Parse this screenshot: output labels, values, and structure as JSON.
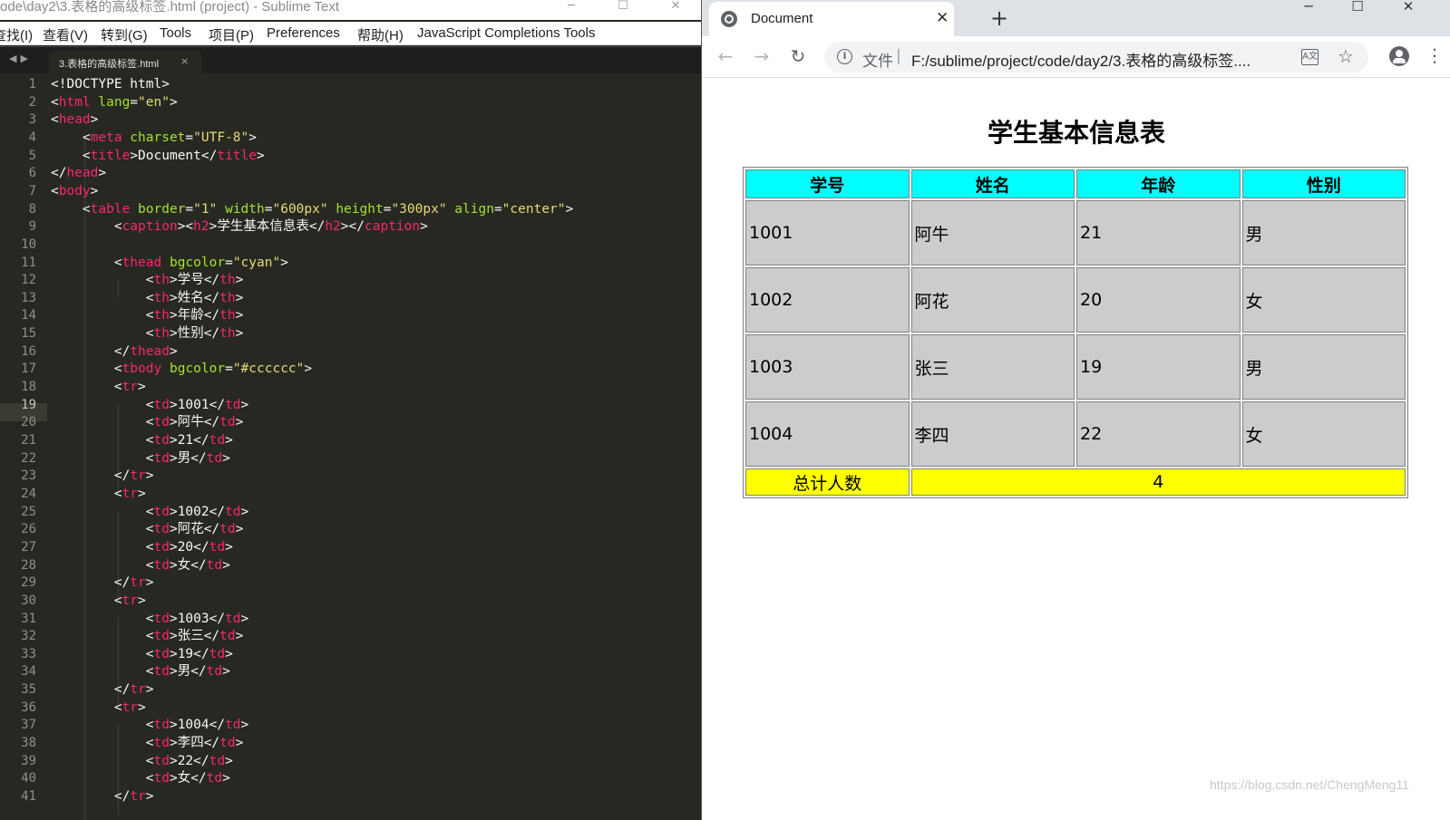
{
  "sublime": {
    "window_title": "ode\\day2\\3.表格的高级标签.html (project) - Sublime Text",
    "menu": [
      "查找(I)",
      "查看(V)",
      "转到(G)",
      "Tools",
      "项目(P)",
      "Preferences",
      "帮助(H)",
      "JavaScript Completions Tools"
    ],
    "tab_label": "3.表格的高级标签.html",
    "tab_close": "×",
    "current_line": 19,
    "line_numbers": [
      "1",
      "2",
      "3",
      "4",
      "5",
      "6",
      "7",
      "8",
      "9",
      "10",
      "11",
      "12",
      "13",
      "14",
      "15",
      "16",
      "17",
      "18",
      "19",
      "20",
      "21",
      "22",
      "23",
      "24",
      "25",
      "26",
      "27",
      "28",
      "29",
      "30",
      "31",
      "32",
      "33",
      "34",
      "35",
      "36",
      "37",
      "38",
      "39",
      "40",
      "41"
    ],
    "code_lines": [
      [
        [
          "t",
          "<!DOCTYPE html>"
        ]
      ],
      [
        [
          "t",
          "<"
        ],
        [
          "g",
          "html"
        ],
        [
          "a",
          " lang"
        ],
        [
          "t",
          "="
        ],
        [
          "s",
          "\"en\""
        ],
        [
          "t",
          ">"
        ]
      ],
      [
        [
          "t",
          "<"
        ],
        [
          "g",
          "head"
        ],
        [
          "t",
          ">"
        ]
      ],
      [
        [
          "t",
          "    <"
        ],
        [
          "g",
          "meta"
        ],
        [
          "a",
          " charset"
        ],
        [
          "t",
          "="
        ],
        [
          "s",
          "\"UTF-8\""
        ],
        [
          "t",
          ">"
        ]
      ],
      [
        [
          "t",
          "    <"
        ],
        [
          "g",
          "title"
        ],
        [
          "t",
          ">Document</"
        ],
        [
          "g",
          "title"
        ],
        [
          "t",
          ">"
        ]
      ],
      [
        [
          "t",
          "</"
        ],
        [
          "g",
          "head"
        ],
        [
          "t",
          ">"
        ]
      ],
      [
        [
          "t",
          "<"
        ],
        [
          "g",
          "body"
        ],
        [
          "t",
          ">"
        ]
      ],
      [
        [
          "t",
          "    <"
        ],
        [
          "g",
          "table"
        ],
        [
          "a",
          " border"
        ],
        [
          "t",
          "="
        ],
        [
          "s",
          "\"1\""
        ],
        [
          "a",
          " width"
        ],
        [
          "t",
          "="
        ],
        [
          "s",
          "\"600px\""
        ],
        [
          "a",
          " height"
        ],
        [
          "t",
          "="
        ],
        [
          "s",
          "\"300px\""
        ],
        [
          "a",
          " align"
        ],
        [
          "t",
          "="
        ],
        [
          "s",
          "\"center\""
        ],
        [
          "t",
          ">"
        ]
      ],
      [
        [
          "t",
          "        <"
        ],
        [
          "g",
          "caption"
        ],
        [
          "t",
          "><"
        ],
        [
          "g",
          "h2"
        ],
        [
          "t",
          ">学生基本信息表</"
        ],
        [
          "g",
          "h2"
        ],
        [
          "t",
          "></"
        ],
        [
          "g",
          "caption"
        ],
        [
          "t",
          ">"
        ]
      ],
      [],
      [
        [
          "t",
          "        <"
        ],
        [
          "g",
          "thead"
        ],
        [
          "a",
          " bgcolor"
        ],
        [
          "t",
          "="
        ],
        [
          "s",
          "\"cyan\""
        ],
        [
          "t",
          ">"
        ]
      ],
      [
        [
          "t",
          "            <"
        ],
        [
          "g",
          "th"
        ],
        [
          "t",
          ">学号</"
        ],
        [
          "g",
          "th"
        ],
        [
          "t",
          ">"
        ]
      ],
      [
        [
          "t",
          "            <"
        ],
        [
          "g",
          "th"
        ],
        [
          "t",
          ">姓名</"
        ],
        [
          "g",
          "th"
        ],
        [
          "t",
          ">"
        ]
      ],
      [
        [
          "t",
          "            <"
        ],
        [
          "g",
          "th"
        ],
        [
          "t",
          ">年龄</"
        ],
        [
          "g",
          "th"
        ],
        [
          "t",
          ">"
        ]
      ],
      [
        [
          "t",
          "            <"
        ],
        [
          "g",
          "th"
        ],
        [
          "t",
          ">性别</"
        ],
        [
          "g",
          "th"
        ],
        [
          "t",
          ">"
        ]
      ],
      [
        [
          "t",
          "        </"
        ],
        [
          "g",
          "thead"
        ],
        [
          "t",
          ">"
        ]
      ],
      [
        [
          "t",
          "        <"
        ],
        [
          "g",
          "tbody"
        ],
        [
          "a",
          " bgcolor"
        ],
        [
          "t",
          "="
        ],
        [
          "s",
          "\"#cccccc\""
        ],
        [
          "t",
          ">"
        ]
      ],
      [
        [
          "t",
          "        <"
        ],
        [
          "g",
          "tr"
        ],
        [
          "t",
          ">"
        ]
      ],
      [
        [
          "t",
          "            <"
        ],
        [
          "g",
          "td"
        ],
        [
          "t",
          ">1001</"
        ],
        [
          "g",
          "td"
        ],
        [
          "t",
          ">"
        ]
      ],
      [
        [
          "t",
          "            <"
        ],
        [
          "g",
          "td"
        ],
        [
          "t",
          ">阿牛</"
        ],
        [
          "g",
          "td"
        ],
        [
          "t",
          ">"
        ]
      ],
      [
        [
          "t",
          "            <"
        ],
        [
          "g",
          "td"
        ],
        [
          "t",
          ">21</"
        ],
        [
          "g",
          "td"
        ],
        [
          "t",
          ">"
        ]
      ],
      [
        [
          "t",
          "            <"
        ],
        [
          "g",
          "td"
        ],
        [
          "t",
          ">男</"
        ],
        [
          "g",
          "td"
        ],
        [
          "t",
          ">"
        ]
      ],
      [
        [
          "t",
          "        </"
        ],
        [
          "g",
          "tr"
        ],
        [
          "t",
          ">"
        ]
      ],
      [
        [
          "t",
          "        <"
        ],
        [
          "g",
          "tr"
        ],
        [
          "t",
          ">"
        ]
      ],
      [
        [
          "t",
          "            <"
        ],
        [
          "g",
          "td"
        ],
        [
          "t",
          ">1002</"
        ],
        [
          "g",
          "td"
        ],
        [
          "t",
          ">"
        ]
      ],
      [
        [
          "t",
          "            <"
        ],
        [
          "g",
          "td"
        ],
        [
          "t",
          ">阿花</"
        ],
        [
          "g",
          "td"
        ],
        [
          "t",
          ">"
        ]
      ],
      [
        [
          "t",
          "            <"
        ],
        [
          "g",
          "td"
        ],
        [
          "t",
          ">20</"
        ],
        [
          "g",
          "td"
        ],
        [
          "t",
          ">"
        ]
      ],
      [
        [
          "t",
          "            <"
        ],
        [
          "g",
          "td"
        ],
        [
          "t",
          ">女</"
        ],
        [
          "g",
          "td"
        ],
        [
          "t",
          ">"
        ]
      ],
      [
        [
          "t",
          "        </"
        ],
        [
          "g",
          "tr"
        ],
        [
          "t",
          ">"
        ]
      ],
      [
        [
          "t",
          "        <"
        ],
        [
          "g",
          "tr"
        ],
        [
          "t",
          ">"
        ]
      ],
      [
        [
          "t",
          "            <"
        ],
        [
          "g",
          "td"
        ],
        [
          "t",
          ">1003</"
        ],
        [
          "g",
          "td"
        ],
        [
          "t",
          ">"
        ]
      ],
      [
        [
          "t",
          "            <"
        ],
        [
          "g",
          "td"
        ],
        [
          "t",
          ">张三</"
        ],
        [
          "g",
          "td"
        ],
        [
          "t",
          ">"
        ]
      ],
      [
        [
          "t",
          "            <"
        ],
        [
          "g",
          "td"
        ],
        [
          "t",
          ">19</"
        ],
        [
          "g",
          "td"
        ],
        [
          "t",
          ">"
        ]
      ],
      [
        [
          "t",
          "            <"
        ],
        [
          "g",
          "td"
        ],
        [
          "t",
          ">男</"
        ],
        [
          "g",
          "td"
        ],
        [
          "t",
          ">"
        ]
      ],
      [
        [
          "t",
          "        </"
        ],
        [
          "g",
          "tr"
        ],
        [
          "t",
          ">"
        ]
      ],
      [
        [
          "t",
          "        <"
        ],
        [
          "g",
          "tr"
        ],
        [
          "t",
          ">"
        ]
      ],
      [
        [
          "t",
          "            <"
        ],
        [
          "g",
          "td"
        ],
        [
          "t",
          ">1004</"
        ],
        [
          "g",
          "td"
        ],
        [
          "t",
          ">"
        ]
      ],
      [
        [
          "t",
          "            <"
        ],
        [
          "g",
          "td"
        ],
        [
          "t",
          ">李四</"
        ],
        [
          "g",
          "td"
        ],
        [
          "t",
          ">"
        ]
      ],
      [
        [
          "t",
          "            <"
        ],
        [
          "g",
          "td"
        ],
        [
          "t",
          ">22</"
        ],
        [
          "g",
          "td"
        ],
        [
          "t",
          ">"
        ]
      ],
      [
        [
          "t",
          "            <"
        ],
        [
          "g",
          "td"
        ],
        [
          "t",
          ">女</"
        ],
        [
          "g",
          "td"
        ],
        [
          "t",
          ">"
        ]
      ],
      [
        [
          "t",
          "        </"
        ],
        [
          "g",
          "tr"
        ],
        [
          "t",
          ">"
        ]
      ]
    ],
    "colors": {
      "background": "#272822",
      "tag": "#f92672",
      "attribute": "#a6e22e",
      "string": "#e6db74",
      "text": "#f8f8f2",
      "gutter": "#8f908a"
    }
  },
  "chrome": {
    "tab_title": "Document",
    "tab_close": "✕",
    "new_tab": "+",
    "address": {
      "scheme_label": "文件",
      "separator": "|",
      "url": "F:/sublime/project/code/day2/3.表格的高级标签...."
    },
    "icons": [
      "globe-icon",
      "back-arrow-icon",
      "forward-arrow-icon",
      "reload-icon",
      "info-icon",
      "translate-icon",
      "star-icon",
      "profile-icon",
      "menu-dots-icon",
      "minimize-icon",
      "maximize-icon",
      "close-icon"
    ]
  },
  "page": {
    "caption": "学生基本信息表",
    "headers": [
      "学号",
      "姓名",
      "年龄",
      "性别"
    ],
    "rows": [
      [
        "1001",
        "阿牛",
        "21",
        "男"
      ],
      [
        "1002",
        "阿花",
        "20",
        "女"
      ],
      [
        "1003",
        "张三",
        "19",
        "男"
      ],
      [
        "1004",
        "李四",
        "22",
        "女"
      ]
    ],
    "footer": {
      "label": "总计人数",
      "value": "4"
    },
    "colors": {
      "thead": "#00ffff",
      "tbody": "#cccccc",
      "tfoot": "#ffff00"
    },
    "watermark": "https://blog.csdn.net/ChengMeng11"
  }
}
